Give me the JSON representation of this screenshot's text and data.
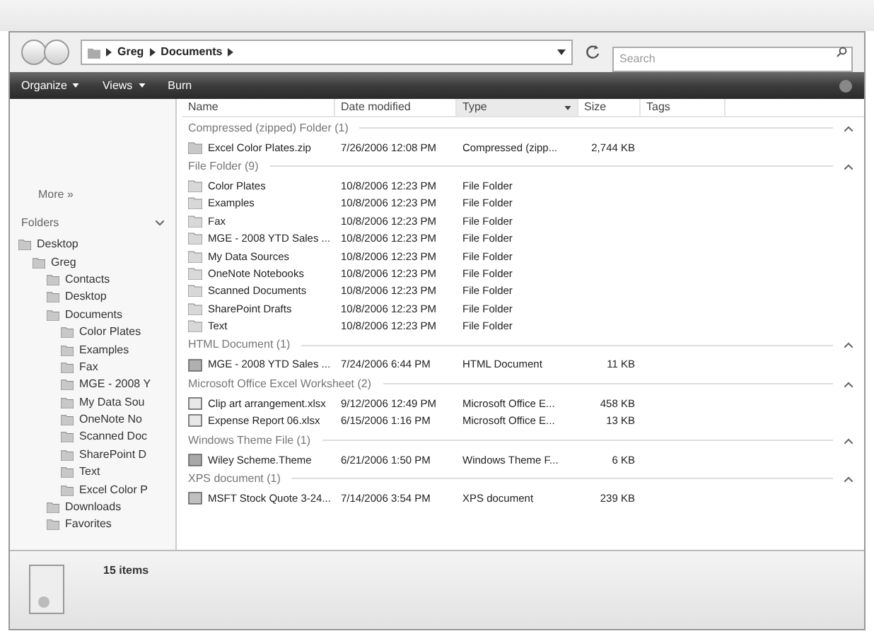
{
  "address_bar": {
    "path": [
      "Greg",
      "Documents"
    ]
  },
  "search": {
    "placeholder": "Search"
  },
  "toolbar": {
    "buttons": [
      {
        "label": "Organize",
        "kind": "menu"
      },
      {
        "label": "Views",
        "kind": "menu"
      },
      {
        "label": "Burn",
        "kind": "plain"
      }
    ]
  },
  "nav_pane": {
    "more_link": "More »",
    "folders_label": "Folders",
    "tree": [
      {
        "label": "Desktop",
        "children": [
          {
            "label": "Greg",
            "children": [
              {
                "label": "Contacts"
              },
              {
                "label": "Desktop"
              },
              {
                "label": "Documents",
                "children": [
                  {
                    "label": "Color Plates"
                  },
                  {
                    "label": "Examples"
                  },
                  {
                    "label": "Fax"
                  },
                  {
                    "label": "MGE - 2008 Y"
                  },
                  {
                    "label": "My Data Sou"
                  },
                  {
                    "label": "OneNote No"
                  },
                  {
                    "label": "Scanned Doc"
                  },
                  {
                    "label": "SharePoint D"
                  },
                  {
                    "label": "Text"
                  },
                  {
                    "label": "Excel Color P"
                  }
                ]
              },
              {
                "label": "Downloads"
              },
              {
                "label": "Favorites"
              }
            ]
          }
        ]
      }
    ]
  },
  "columns": [
    {
      "label": "Name",
      "sorted": false
    },
    {
      "label": "Date modified",
      "sorted": false
    },
    {
      "label": "Type",
      "sorted": true
    },
    {
      "label": "Size",
      "sorted": false
    },
    {
      "label": "Tags",
      "sorted": false
    }
  ],
  "groups": [
    {
      "title": "Compressed (zipped) Folder (1)",
      "expanded": true,
      "files": [
        {
          "name": "Excel Color Plates.zip",
          "date": "7/26/2006 12:08 PM",
          "type": "Compressed (zipp...",
          "size": "2,744 KB",
          "kind": "zip"
        }
      ]
    },
    {
      "title": "File Folder (9)",
      "expanded": true,
      "files": [
        {
          "name": "Color Plates",
          "date": "10/8/2006 12:23 PM",
          "type": "File Folder",
          "kind": "folder"
        },
        {
          "name": "Examples",
          "date": "10/8/2006 12:23 PM",
          "type": "File Folder",
          "kind": "folder"
        },
        {
          "name": "Fax",
          "date": "10/8/2006 12:23 PM",
          "type": "File Folder",
          "kind": "folder"
        },
        {
          "name": "MGE - 2008 YTD Sales ...",
          "date": "10/8/2006 12:23 PM",
          "type": "File Folder",
          "kind": "folder"
        },
        {
          "name": "My Data Sources",
          "date": "10/8/2006 12:23 PM",
          "type": "File Folder",
          "kind": "folder"
        },
        {
          "name": "OneNote Notebooks",
          "date": "10/8/2006 12:23 PM",
          "type": "File Folder",
          "kind": "folder"
        },
        {
          "name": "Scanned Documents",
          "date": "10/8/2006 12:23 PM",
          "type": "File Folder",
          "kind": "folder"
        },
        {
          "name": "SharePoint Drafts",
          "date": "10/8/2006 12:23 PM",
          "type": "File Folder",
          "kind": "folder"
        },
        {
          "name": "Text",
          "date": "10/8/2006 12:23 PM",
          "type": "File Folder",
          "kind": "folder"
        }
      ]
    },
    {
      "title": "HTML Document (1)",
      "expanded": true,
      "files": [
        {
          "name": "MGE - 2008 YTD Sales ...",
          "date": "7/24/2006 6:44 PM",
          "type": "HTML Document",
          "size": "11 KB",
          "kind": "html"
        }
      ]
    },
    {
      "title": "Microsoft Office Excel Worksheet (2)",
      "expanded": true,
      "files": [
        {
          "name": "Clip art arrangement.xlsx",
          "date": "9/12/2006 12:49 PM",
          "type": "Microsoft Office E...",
          "size": "458 KB",
          "kind": "sheet"
        },
        {
          "name": "Expense Report 06.xlsx",
          "date": "6/15/2006 1:16 PM",
          "type": "Microsoft Office E...",
          "size": "13 KB",
          "kind": "sheet"
        }
      ]
    },
    {
      "title": "Windows Theme File (1)",
      "expanded": true,
      "files": [
        {
          "name": "Wiley Scheme.Theme",
          "date": "6/21/2006 1:50 PM",
          "type": "Windows Theme F...",
          "size": "6 KB",
          "kind": "theme"
        }
      ]
    },
    {
      "title": "XPS document (1)",
      "expanded": true,
      "files": [
        {
          "name": "MSFT Stock Quote 3-24...",
          "date": "7/14/2006 3:54 PM",
          "type": "XPS document",
          "size": "239 KB",
          "kind": "xps"
        }
      ]
    }
  ],
  "details_pane": {
    "count": "15 items"
  }
}
